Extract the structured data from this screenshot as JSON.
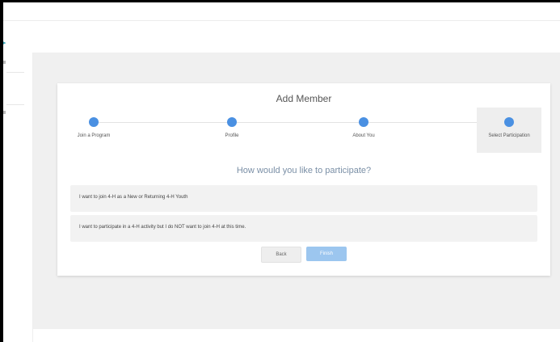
{
  "dialog": {
    "title": "Add Member",
    "steps": [
      {
        "label": "Join a Program"
      },
      {
        "label": "Profile"
      },
      {
        "label": "About You"
      },
      {
        "label": "Select Participation"
      }
    ],
    "question": "How would you like to participate?",
    "options": [
      {
        "label": "I want to join 4-H as a New or Returning 4-H Youth"
      },
      {
        "label": "I want to participate in a 4-H activity but I do NOT want to join 4-H at this time."
      }
    ],
    "back_label": "Back",
    "finish_label": "Finish"
  },
  "colors": {
    "accent": "#4a90e2",
    "primary_button": "#9cc6ef",
    "background": "#f0f0f0"
  }
}
